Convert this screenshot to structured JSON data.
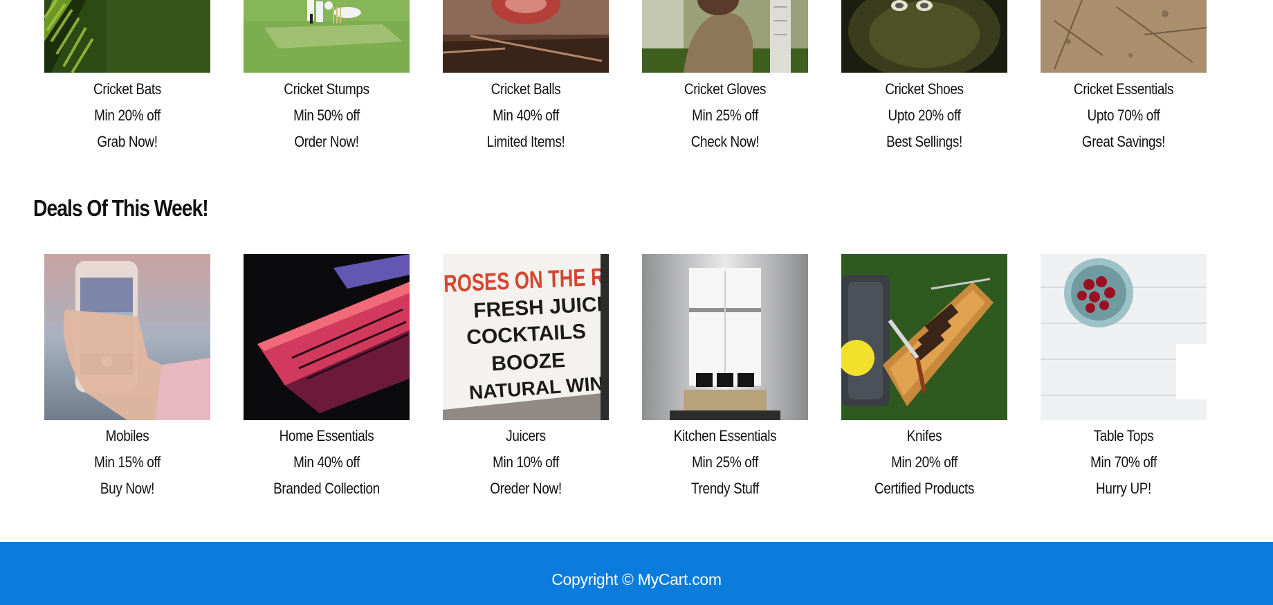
{
  "top_categories": [
    {
      "name": "Cricket Bats",
      "offer": "Min 20% off",
      "cta": "Grab Now!"
    },
    {
      "name": "Cricket Stumps",
      "offer": "Min 50% off",
      "cta": "Order Now!"
    },
    {
      "name": "Cricket Balls",
      "offer": "Min 40% off",
      "cta": "Limited Items!"
    },
    {
      "name": "Cricket Gloves",
      "offer": "Min 25% off",
      "cta": "Check Now!"
    },
    {
      "name": "Cricket Shoes",
      "offer": "Upto 20% off",
      "cta": "Best Sellings!"
    },
    {
      "name": "Cricket Essentials",
      "offer": "Upto 70% off",
      "cta": "Great Savings!"
    }
  ],
  "deals": {
    "title": "Deals Of This Week!",
    "items": [
      {
        "name": "Mobiles",
        "offer": "Min 15% off",
        "cta": "Buy Now!"
      },
      {
        "name": "Home Essentials",
        "offer": "Min 40% off",
        "cta": "Branded Collection"
      },
      {
        "name": "Juicers",
        "offer": "Min 10% off",
        "cta": "Oreder Now!"
      },
      {
        "name": "Kitchen Essentials",
        "offer": "Min 25% off",
        "cta": "Trendy Stuff"
      },
      {
        "name": "Knifes",
        "offer": "Min 20% off",
        "cta": "Certified Products"
      },
      {
        "name": "Table Tops",
        "offer": "Min 70% off",
        "cta": "Hurry UP!"
      }
    ],
    "juicer_sign": {
      "line1": "ROSES ON THE RUN",
      "line2": "FRESH JUICE",
      "line3": "COCKTAILS",
      "line4": "BOOZE",
      "line5": "NATURAL WINE"
    }
  },
  "footer": {
    "copyright": "Copyright © MyCart.com"
  },
  "colors": {
    "footer_bg": "#0b7cdc",
    "footer_text": "#ffffff",
    "page_bg": "#ffffff"
  }
}
